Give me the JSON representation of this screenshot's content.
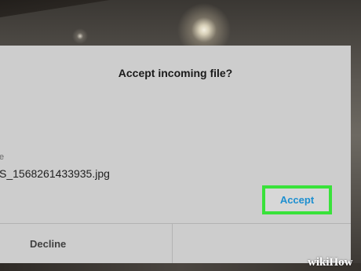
{
  "dialog": {
    "title": "Accept incoming file?",
    "meta_label": "e",
    "file_name": "S_1568261433935.jpg",
    "decline_label": "Decline",
    "accept_label": "Accept"
  },
  "watermark": "wikiHow",
  "colors": {
    "dialog_bg": "#cdcdcd",
    "accept_text": "#1d8fd0",
    "highlight": "#39e23a"
  }
}
